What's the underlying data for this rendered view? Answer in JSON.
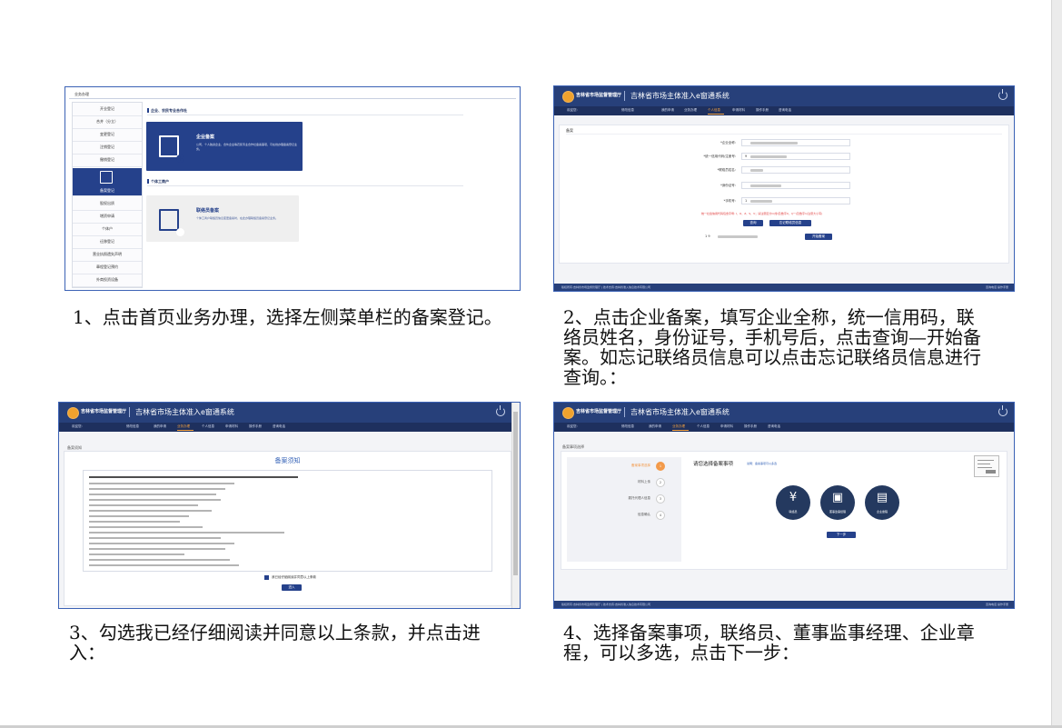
{
  "captions": {
    "step1": "1、点击首页业务办理，选择左侧菜单栏的备案登记。",
    "step2_line1": "2、点击企业备案，填写企业全称，统一信用码，联",
    "step2_line2": "络员姓名，身份证号，手机号后，点击查询—开始备",
    "step2_line3": "案。如忘记联络员信息可以点击忘记联络员信息进行",
    "step2_line4": "查询。：",
    "step3_line1": "3、勾选我已经仔细阅读并同意以上条款，并点击进",
    "step3_line2": "入：",
    "step4_line1": "4、选择备案事项，联络员、董事监事经理、企业章",
    "step4_line2": "程，可以多选，点击下一步："
  },
  "system": {
    "org_name": "吉林省市场监督管理厅",
    "system_name": "吉林省市场主体准入e窗通系统",
    "nav": [
      "欢迎您:",
      "修改信息",
      "我的申请",
      "业务办理",
      "个人信息",
      "申请材料",
      "操作手册",
      "咨询电话"
    ],
    "footer_left": "版权所有:吉林省市场监督管理厅 | 技术支持:吉林省准入信息技术有限公司",
    "footer_right": "咨询电话  操作手册"
  },
  "shot1": {
    "title": "业务办理",
    "menu": [
      "开业登记",
      "合并（分立）",
      "变更登记",
      "注销登记",
      "撤销登记",
      "备案登记",
      "股权出质",
      "增资申请",
      "个体户",
      "迁移登记",
      "营业执照遗失声明",
      "章程登记预约",
      "外商投资设备"
    ],
    "section_enterprise": "企业、农民专业合作社",
    "section_individual": "个体工商户",
    "card_enterprise_title": "企业备案",
    "card_enterprise_desc": "公司、个人独资企业、合伙企业等农民专业合作社备案事项，可在线办理备案登记业务。",
    "card_liaison_title": "联络员备案",
    "card_liaison_desc": "个体工商户联络员信息变更备案时，在此办理联络员备案登记业务。"
  },
  "shot2": {
    "crumb": "备案",
    "labels": [
      "*企业全称:",
      "*统一信用代码/注册号:",
      "*联络员姓名:",
      "*身份证号:",
      "*手机号:"
    ],
    "values": [
      "",
      "9",
      "",
      "",
      "1"
    ],
    "warning": "统一社会信用代码包含字母: I、O、Z、S、V；请注意区分O(零)及数字0，I(一)及数字1(注意大小写)",
    "button_query": "查询",
    "button_forgot": "忘记联络员信息",
    "result_prefix": "1  9",
    "button_start": "开始备案"
  },
  "shot3": {
    "crumb": "备案须知",
    "title": "备案须知",
    "agree_text": "我已经仔细阅读并同意以上条款",
    "enter_button": "进入"
  },
  "shot4": {
    "crumb": "备案事项选择",
    "steps": [
      "备案事项选择",
      "材料上传",
      "委托代理人信息",
      "信息确认"
    ],
    "step_nums": [
      "1",
      "2",
      "3",
      "4"
    ],
    "heading": "请您选择备案事项",
    "hint": "说明：备案事项可以多选",
    "options": [
      {
        "label": "联络员",
        "glyph": "¥"
      },
      {
        "label": "董事监事经理",
        "glyph": "▣"
      },
      {
        "label": "企业章程",
        "glyph": "▤"
      }
    ],
    "next_button": "下一步"
  }
}
